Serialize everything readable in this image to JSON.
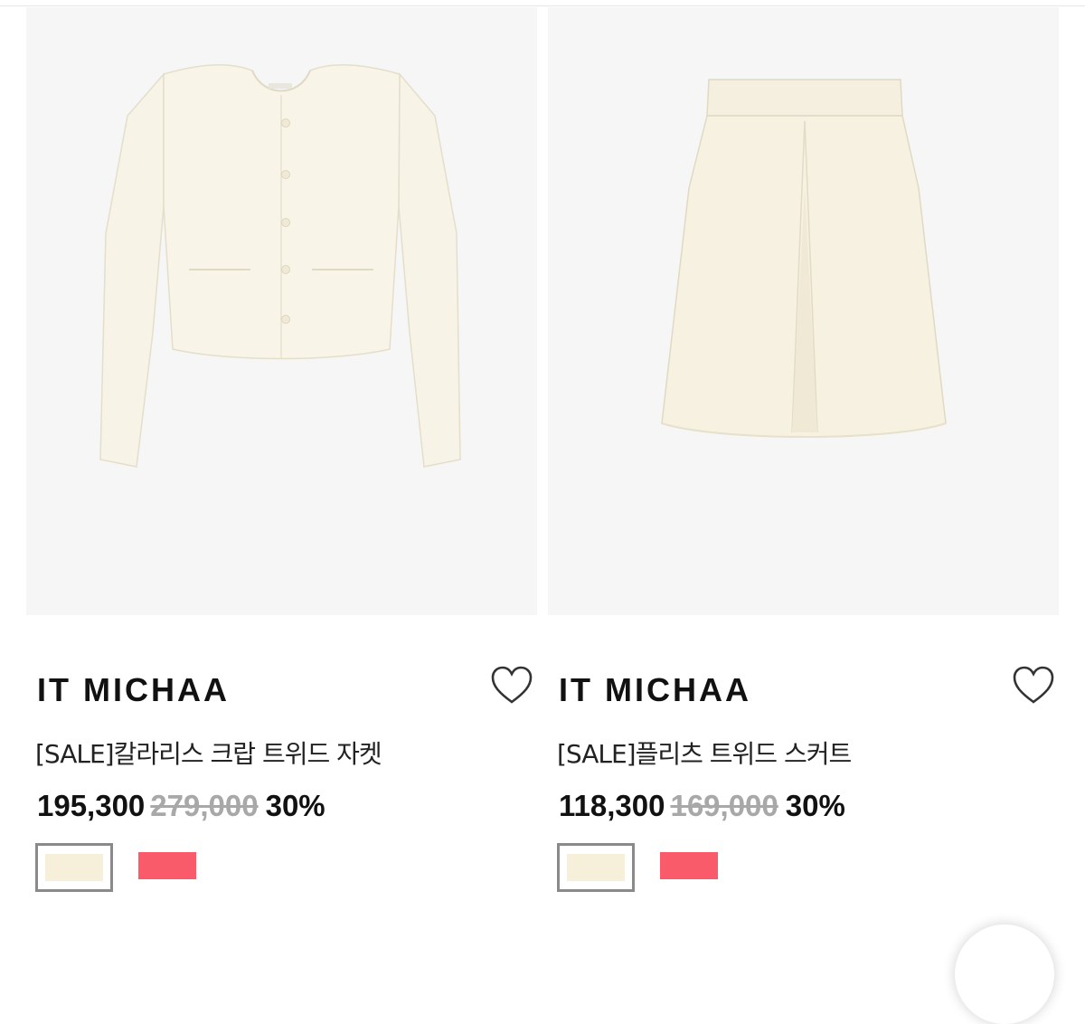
{
  "products": [
    {
      "brand": "IT MICHAA",
      "name": "[SALE]칼라리스 크랍 트위드 자켓",
      "sale_price": "195,300",
      "original_price": "279,000",
      "discount": "30%",
      "image": "cream-tweed-cropped-jacket",
      "colors": [
        "#f6efd9",
        "#fa5b6a"
      ],
      "selected_color_index": 0
    },
    {
      "brand": "IT MICHAA",
      "name": "[SALE]플리츠 트위드 스커트",
      "sale_price": "118,300",
      "original_price": "169,000",
      "discount": "30%",
      "image": "cream-tweed-pleated-skirt",
      "colors": [
        "#f6efd9",
        "#fa5b6a"
      ],
      "selected_color_index": 0
    }
  ],
  "icons": {
    "wishlist": "heart-outline-icon"
  },
  "theme": {
    "photo_bg": "#f6f6f6",
    "garment": "#f7f3e6",
    "strike": "#a8a8a8"
  }
}
